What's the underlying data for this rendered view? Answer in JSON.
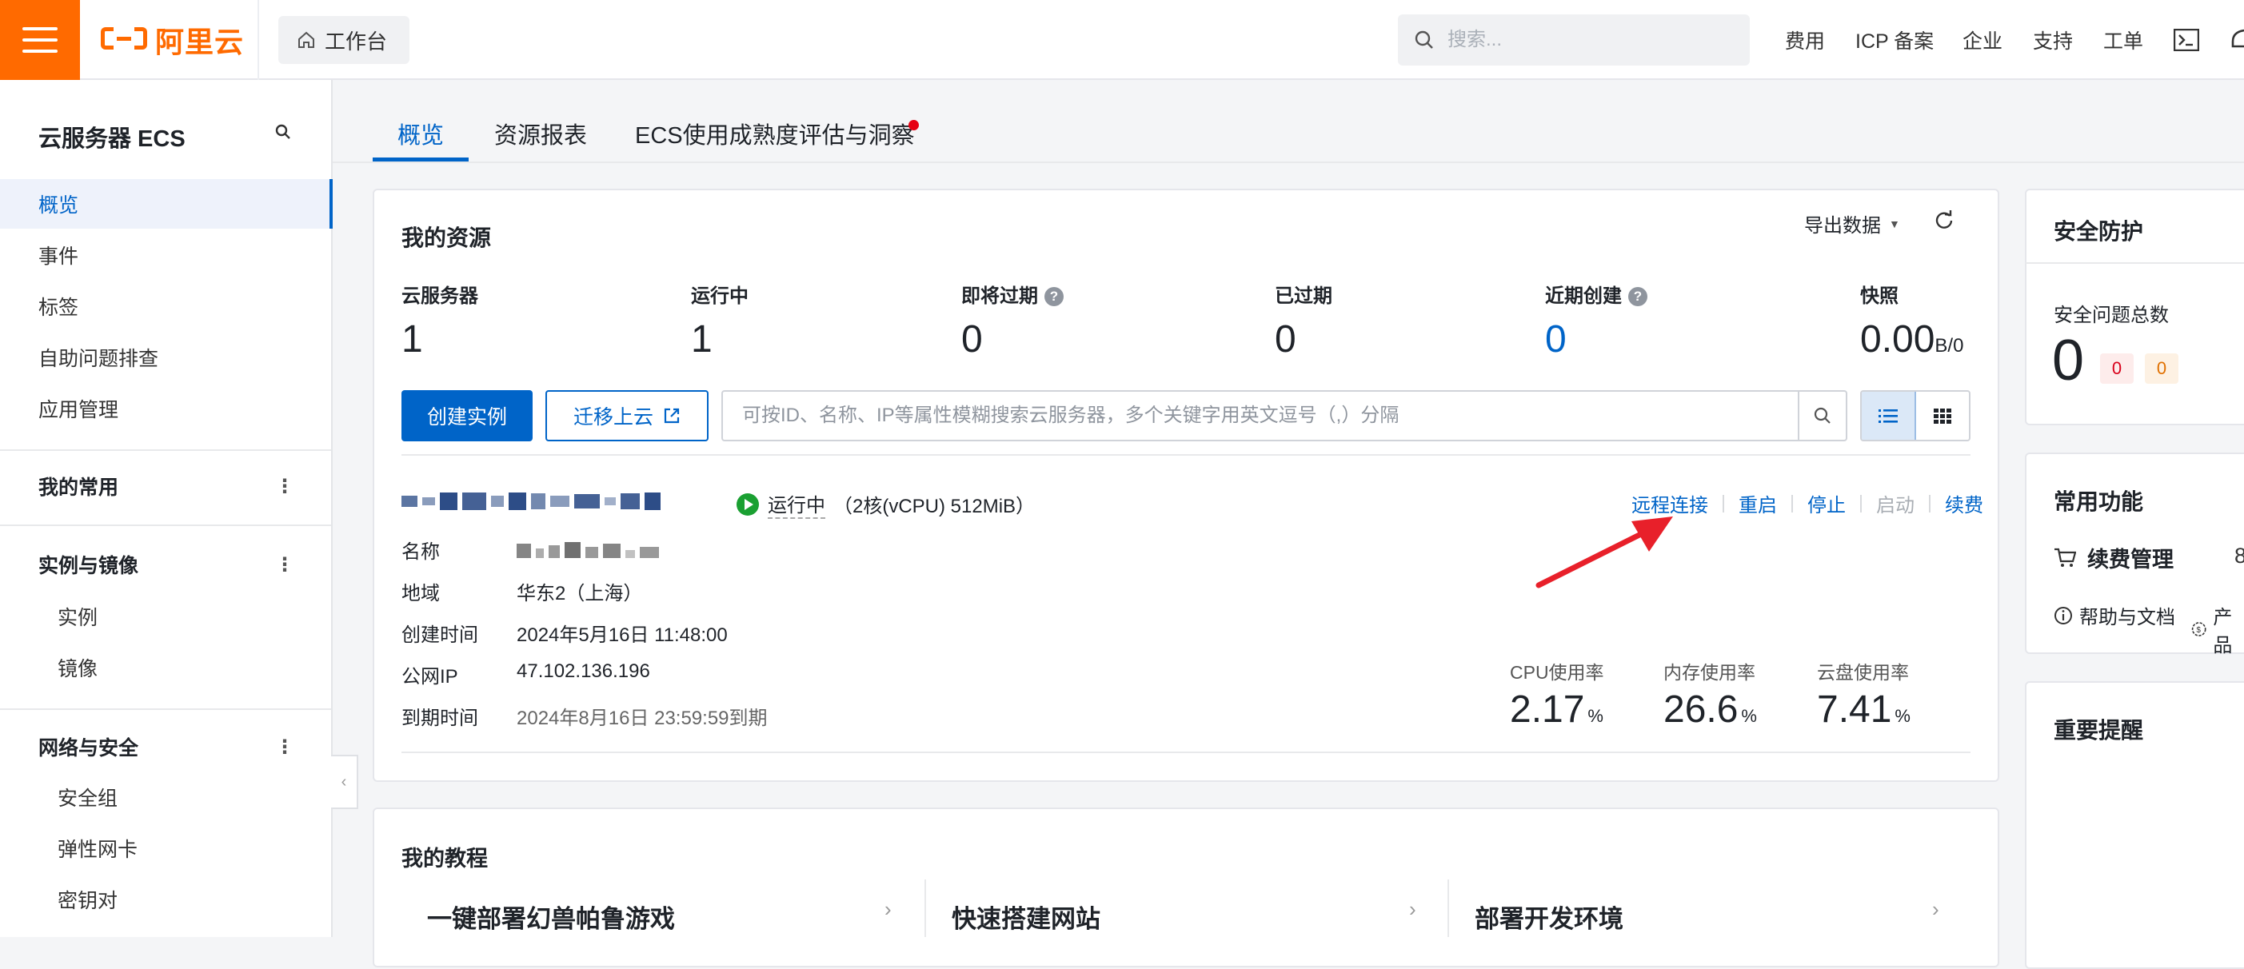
{
  "topbar": {
    "logo_text": "阿里云",
    "workbench_label": "工作台",
    "search_placeholder": "搜索...",
    "nav": [
      "费用",
      "ICP 备案",
      "企业",
      "支持",
      "工单"
    ]
  },
  "sidebar": {
    "title": "云服务器 ECS",
    "items_top": [
      "概览",
      "事件",
      "标签",
      "自助问题排查",
      "应用管理"
    ],
    "group_common": "我的常用",
    "group_instances": "实例与镜像",
    "instances_items": [
      "实例",
      "镜像"
    ],
    "group_network": "网络与安全",
    "network_items": [
      "安全组",
      "弹性网卡",
      "密钥对"
    ]
  },
  "tabs": [
    "概览",
    "资源报表",
    "ECS使用成熟度评估与洞察"
  ],
  "resources": {
    "title": "我的资源",
    "export_label": "导出数据",
    "stats": [
      {
        "label": "云服务器",
        "value": "1"
      },
      {
        "label": "运行中",
        "value": "1"
      },
      {
        "label": "即将过期",
        "value": "0"
      },
      {
        "label": "已过期",
        "value": "0"
      },
      {
        "label": "近期创建",
        "value": "0"
      },
      {
        "label": "快照",
        "value": "0.00",
        "unit": "B/0"
      }
    ],
    "create_button": "创建实例",
    "migrate_button": "迁移上云",
    "filter_placeholder": "可按ID、名称、IP等属性模糊搜索云服务器，多个关键字用英文逗号（,）分隔"
  },
  "instance": {
    "status": "运行中",
    "spec": "（2核(vCPU) 512MiB）",
    "actions": [
      "远程连接",
      "重启",
      "停止",
      "启动",
      "续费"
    ],
    "fields": [
      {
        "label": "名称",
        "value": ""
      },
      {
        "label": "地域",
        "value": "华东2（上海）"
      },
      {
        "label": "创建时间",
        "value": "2024年5月16日 11:48:00"
      },
      {
        "label": "公网IP",
        "value": "47.102.136.196"
      },
      {
        "label": "到期时间",
        "value": "2024年8月16日 23:59:59到期"
      }
    ],
    "metrics": [
      {
        "label": "CPU使用率",
        "value": "2.17",
        "unit": "%"
      },
      {
        "label": "内存使用率",
        "value": "26.6",
        "unit": "%"
      },
      {
        "label": "云盘使用率",
        "value": "7.41",
        "unit": "%"
      }
    ]
  },
  "tutorials": {
    "title": "我的教程",
    "items": [
      "一键部署幻兽帕鲁游戏",
      "快速搭建网站",
      "部署开发环境"
    ]
  },
  "security": {
    "title": "安全防护",
    "total_label": "安全问题总数",
    "total_value": "0",
    "badge_red": "0",
    "badge_orange": "0"
  },
  "common": {
    "title": "常用功能",
    "renew": "续费管理",
    "help": "帮助与文档",
    "product_partial": "产品"
  },
  "reminder": {
    "title": "重要提醒"
  },
  "colors": {
    "brand": "#ff6a00",
    "primary": "#0064c8",
    "running": "#1aa032",
    "alert": "#e60012"
  }
}
